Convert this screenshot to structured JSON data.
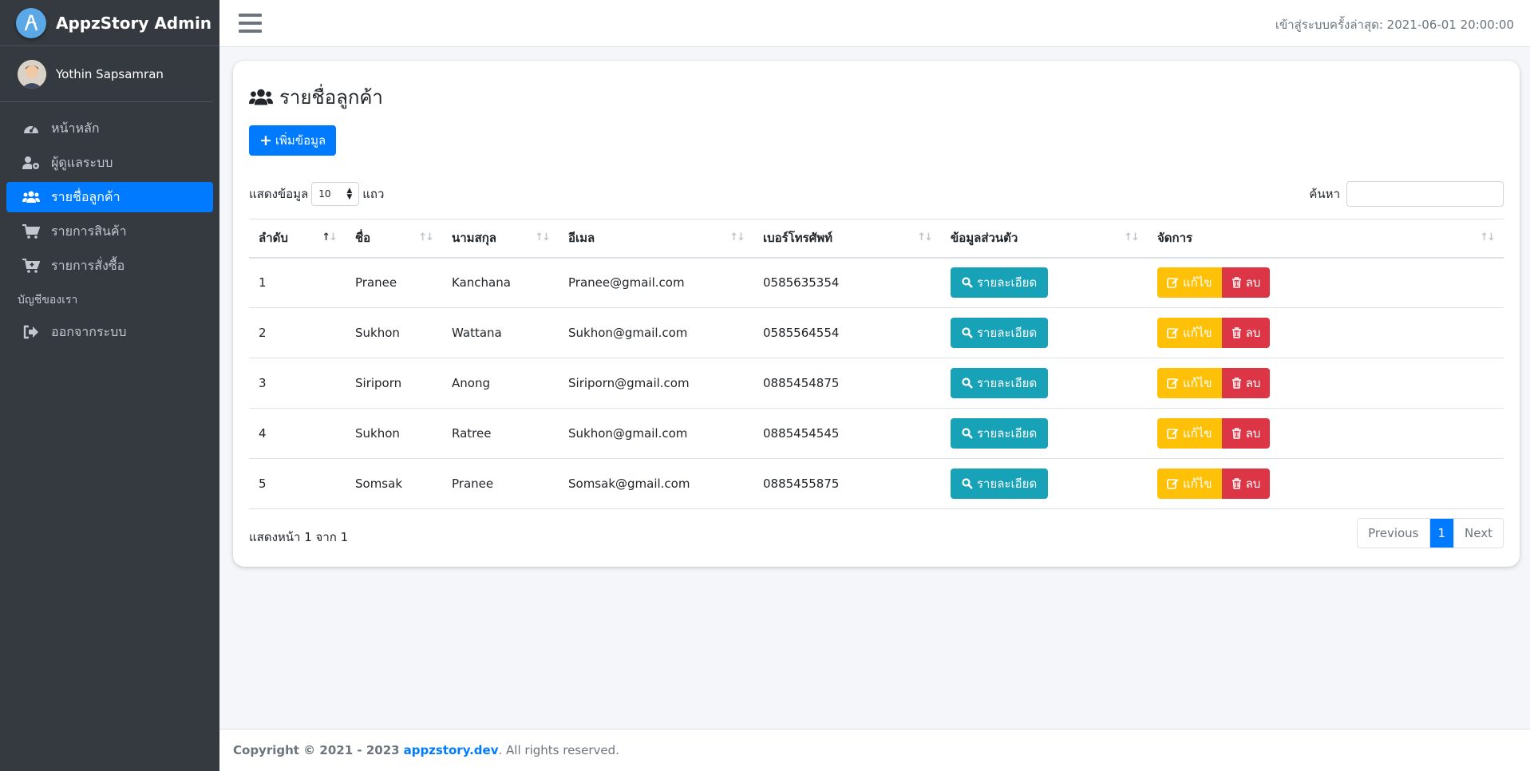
{
  "brand": {
    "name": "AppzStory Admin"
  },
  "user": {
    "name": "Yothin Sapsamran"
  },
  "sidebar": {
    "items": [
      {
        "label": "หน้าหลัก",
        "icon": "dashboard-icon"
      },
      {
        "label": "ผู้ดูแลระบบ",
        "icon": "user-cog-icon"
      },
      {
        "label": "รายชื่อลูกค้า",
        "icon": "users-icon",
        "active": true
      },
      {
        "label": "รายการสินค้า",
        "icon": "cart-icon"
      },
      {
        "label": "รายการสั่งซื้อ",
        "icon": "cart-plus-icon"
      }
    ],
    "section_header": "บัญชีของเรา",
    "logout_label": "ออกจากระบบ"
  },
  "topbar": {
    "last_login": "เข้าสู่ระบบครั้งล่าสุด: 2021-06-01 20:00:00"
  },
  "page": {
    "title": "รายชื่อลูกค้า",
    "add_button": "เพิ่มข้อมูล",
    "length_prefix": "แสดงข้อมูล",
    "length_value": "10",
    "length_suffix": "แถว",
    "search_label": "ค้นหา",
    "search_value": ""
  },
  "table": {
    "columns": [
      "ลำดับ",
      "ชื่อ",
      "นามสกุล",
      "อีเมล",
      "เบอร์โทรศัพท์",
      "ข้อมูลส่วนตัว",
      "จัดการ"
    ],
    "rows": [
      {
        "no": "1",
        "first": "Pranee",
        "last": "Kanchana",
        "email": "Pranee@gmail.com",
        "phone": "0585635354"
      },
      {
        "no": "2",
        "first": "Sukhon",
        "last": "Wattana",
        "email": "Sukhon@gmail.com",
        "phone": "0585564554"
      },
      {
        "no": "3",
        "first": "Siriporn",
        "last": "Anong",
        "email": "Siriporn@gmail.com",
        "phone": "0885454875"
      },
      {
        "no": "4",
        "first": "Sukhon",
        "last": "Ratree",
        "email": "Sukhon@gmail.com",
        "phone": "0885454545"
      },
      {
        "no": "5",
        "first": "Somsak",
        "last": "Pranee",
        "email": "Somsak@gmail.com",
        "phone": "0885455875"
      }
    ],
    "detail_label": "รายละเอียด",
    "edit_label": "แก้ไข",
    "delete_label": "ลบ"
  },
  "pagination": {
    "info": "แสดงหน้า 1 จาก 1",
    "previous": "Previous",
    "current": "1",
    "next": "Next"
  },
  "footer": {
    "copyright": "Copyright © 2021 - 2023",
    "site": "appzstory.dev",
    "rights": ". All rights reserved."
  },
  "colors": {
    "primary": "#007bff",
    "info": "#17a2b8",
    "warning": "#ffc107",
    "danger": "#dc3545",
    "sidebar": "#343a40"
  }
}
